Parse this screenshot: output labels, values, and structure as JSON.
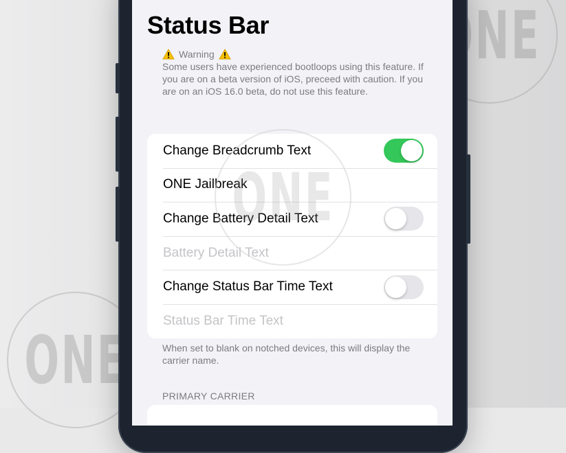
{
  "page": {
    "title": "Status Bar"
  },
  "warning": {
    "heading": "Warning",
    "body": "Some users have experienced bootloops using this feature. If you are on a beta version of iOS, preceed with caution. If you are on an iOS 16.0 beta, do not use this feature."
  },
  "settings": {
    "rows": [
      {
        "label": "Change Breadcrumb Text",
        "type": "toggle",
        "on": true
      },
      {
        "label": "ONE Jailbreak",
        "type": "text-field"
      },
      {
        "label": "Change Battery Detail Text",
        "type": "toggle",
        "on": false
      },
      {
        "label": "Battery Detail Text",
        "type": "placeholder-field"
      },
      {
        "label": "Change Status Bar Time Text",
        "type": "toggle",
        "on": false
      },
      {
        "label": "Status Bar Time Text",
        "type": "placeholder-field"
      }
    ],
    "footer": "When set to blank on notched devices, this will display the carrier name."
  },
  "section": {
    "primary_carrier": "PRIMARY CARRIER"
  },
  "watermark": {
    "text": "ONE"
  },
  "colors": {
    "toggle_on": "#34c759",
    "toggle_off": "#e6e6ea",
    "warning_yellow": "#f5c000"
  },
  "icons": [
    "warning-icon"
  ]
}
